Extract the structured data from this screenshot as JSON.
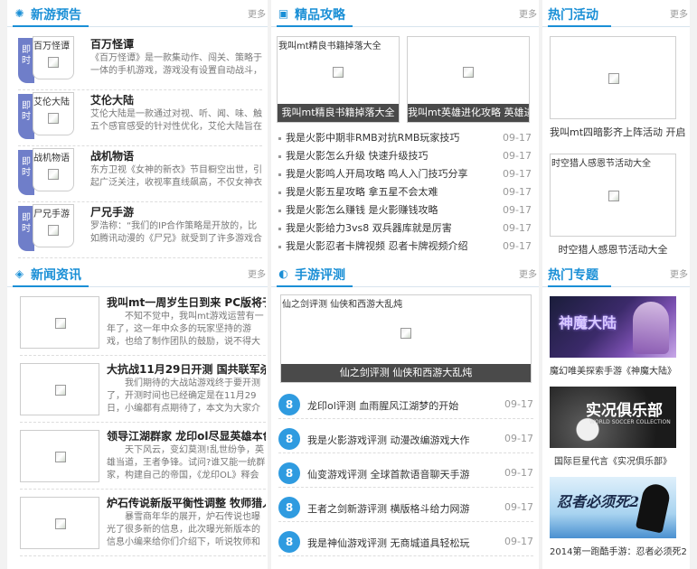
{
  "new_games": {
    "title": "新游预告",
    "more": "更多",
    "tag": "即时",
    "items": [
      {
        "thumb_alt": "百万怪谭",
        "title": "百万怪谭",
        "desc": "《百万怪谭》是一款集动作、闯关、策略于一体的手机游戏，游戏没有设置自动战斗，"
      },
      {
        "thumb_alt": "艾伦大陆",
        "title": "艾伦大陆",
        "desc": "艾伦大陆是一款通过对视、听、闻、味、触五个感官感受的针对性优化，艾伦大陆旨在"
      },
      {
        "thumb_alt": "战机物语",
        "title": "战机物语",
        "desc": "东方卫视《女神的新衣》节目橱空出世，引起广泛关注，收视率直线飙高，不仅女神衣"
      },
      {
        "thumb_alt": "尸兄手游",
        "title": "尸兄手游",
        "desc": "罗浩称：“我们的IP合作策略是开放的，比如腾讯动漫的《尸兄》就受到了许多游戏合"
      }
    ]
  },
  "guides": {
    "title": "精品攻略",
    "more": "更多",
    "featured": [
      {
        "alt": "我叫mt精良书籍掉落大全",
        "caption": "我叫mt精良书籍掉落大全"
      },
      {
        "alt": "",
        "caption": "我叫mt英雄进化攻略 英雄进化详"
      }
    ],
    "list": [
      {
        "text": "我是火影中期非RMB对抗RMB玩家技巧",
        "date": "09-17"
      },
      {
        "text": "我是火影怎么升级 快速升级技巧",
        "date": "09-17"
      },
      {
        "text": "我是火影鸣人开局攻略 鸣人入门技巧分享",
        "date": "09-17"
      },
      {
        "text": "我是火影五星攻略 拿五星不会太难",
        "date": "09-17"
      },
      {
        "text": "我是火影怎么赚钱 是火影赚钱攻略",
        "date": "09-17"
      },
      {
        "text": "我是火影给力3vs8 双兵器库就是厉害",
        "date": "09-17"
      },
      {
        "text": "我是火影忍者卡牌视频 忍者卡牌视频介绍",
        "date": "09-17"
      }
    ]
  },
  "activities": {
    "title": "热门活动",
    "more": "更多",
    "items": [
      {
        "alt": "",
        "caption": "我叫mt四暗影齐上阵活动 开启"
      },
      {
        "alt": "时空猎人感恩节活动大全",
        "caption": "时空猎人感恩节活动大全"
      }
    ]
  },
  "news": {
    "title": "新闻资讯",
    "more": "更多",
    "items": [
      {
        "title": "我叫mt一周岁生日到来 PC版将于12",
        "desc": "不知不觉中，我叫mt游戏运营有一年了，这一年中众多的玩家坚持的游戏，也给了制作团队的鼓励，说不得大师"
      },
      {
        "title": "大抗战11月29日开测 国共联军杀鬼",
        "desc": "我们期待的大战站游戏终于要开测了，开测时间也已经确定是在11月29日，小编都有点期待了，本文为大家介绍一下"
      },
      {
        "title": "领导江湖群家 龙印ol尽显英雄本色",
        "desc": "天下风云，变幻莫测!乱世纷争，英雄当道，王者争锋。试问?谁又能一统群家，构建自己的帝国，《龙印OL》释会战，让"
      },
      {
        "title": "炉石传说新版平衡性调整 牧师猎人遭",
        "desc": "暴雪商年华的展开，炉石传说也曝光了很多新的信息，此次曝光新版本的信息小编来给你们介绍下，听说牧师和猎人"
      }
    ]
  },
  "reviews": {
    "title": "手游评测",
    "more": "更多",
    "featured": {
      "alt": "仙之剑评测 仙侠和西游大乱炖",
      "caption": "仙之剑评测 仙侠和西游大乱炖"
    },
    "badge": "8",
    "list": [
      {
        "text": "龙印ol评测 血雨腥风江湖梦的开始",
        "date": "09-17"
      },
      {
        "text": "我是火影游戏评测 动漫改编游戏大作",
        "date": "09-17"
      },
      {
        "text": "仙变游戏评测 全球首款语音聊天手游",
        "date": "09-17"
      },
      {
        "text": "王者之剑新游评测 横版格斗给力网游",
        "date": "09-17"
      },
      {
        "text": "我是神仙游戏评测 无商城道具轻松玩",
        "date": "09-17"
      }
    ]
  },
  "topics": {
    "title": "热门专题",
    "more": "更多",
    "items": [
      {
        "banner": "神魔大陆",
        "caption": "魔幻唯美探索手游《神魔大陆》",
        "colors": [
          "#1a1d3a",
          "#5a3b8a"
        ]
      },
      {
        "banner": "实况俱乐部",
        "sub": "WORLD SOCCER COLLECTION",
        "caption": "国际巨星代言《实况俱乐部》",
        "colors": [
          "#1b1b1b",
          "#6a6a6a"
        ]
      },
      {
        "banner": "忍者必须死2",
        "caption": "2014第一跑酷手游：忍者必须死2",
        "colors": [
          "#cfe6f7",
          "#4a90d0"
        ]
      }
    ]
  },
  "colors": {
    "accent": "#1a8fd6",
    "tag": "#6f7ec9",
    "badge": "#2f9be0",
    "caption_bar": "#4a4a4a"
  }
}
